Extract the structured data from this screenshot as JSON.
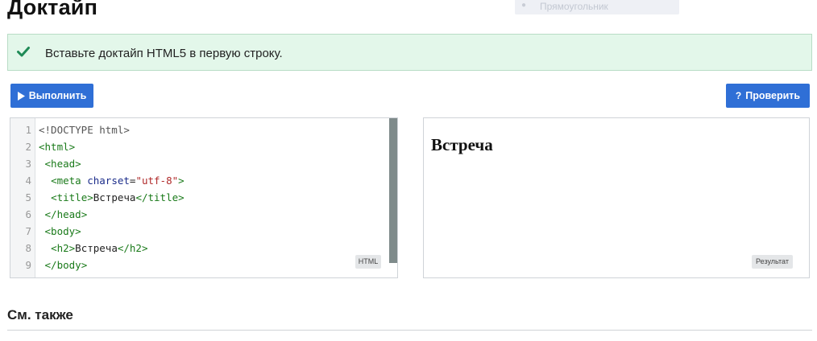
{
  "page": {
    "title": "Доктайп"
  },
  "ghost_menu": {
    "icon": "bullet-icon",
    "label": "Прямоугольник"
  },
  "task": {
    "status_icon": "check-icon",
    "text": "Вставьте доктайп HTML5 в первую строку.",
    "status_color": "#1f8b57",
    "background_color": "#e3f7ea"
  },
  "toolbar": {
    "run_label": "Выполнить",
    "run_icon": "play-icon",
    "check_label": "Проверить",
    "check_icon": "question-icon",
    "button_color": "#2f6fd6"
  },
  "editor": {
    "language_badge": "HTML",
    "line_numbers": [
      "1",
      "2",
      "3",
      "4",
      "5",
      "6",
      "7",
      "8",
      "9"
    ],
    "lines": [
      "<!DOCTYPE html>",
      "<html>",
      " <head>",
      "  <meta charset=\"utf-8\">",
      "  <title>Встреча</title>",
      " </head>",
      " <body>",
      "  <h2>Встреча</h2>",
      " </body>"
    ]
  },
  "preview": {
    "heading": "Встреча",
    "badge": "Результат"
  },
  "see_also": {
    "title": "См. также"
  }
}
